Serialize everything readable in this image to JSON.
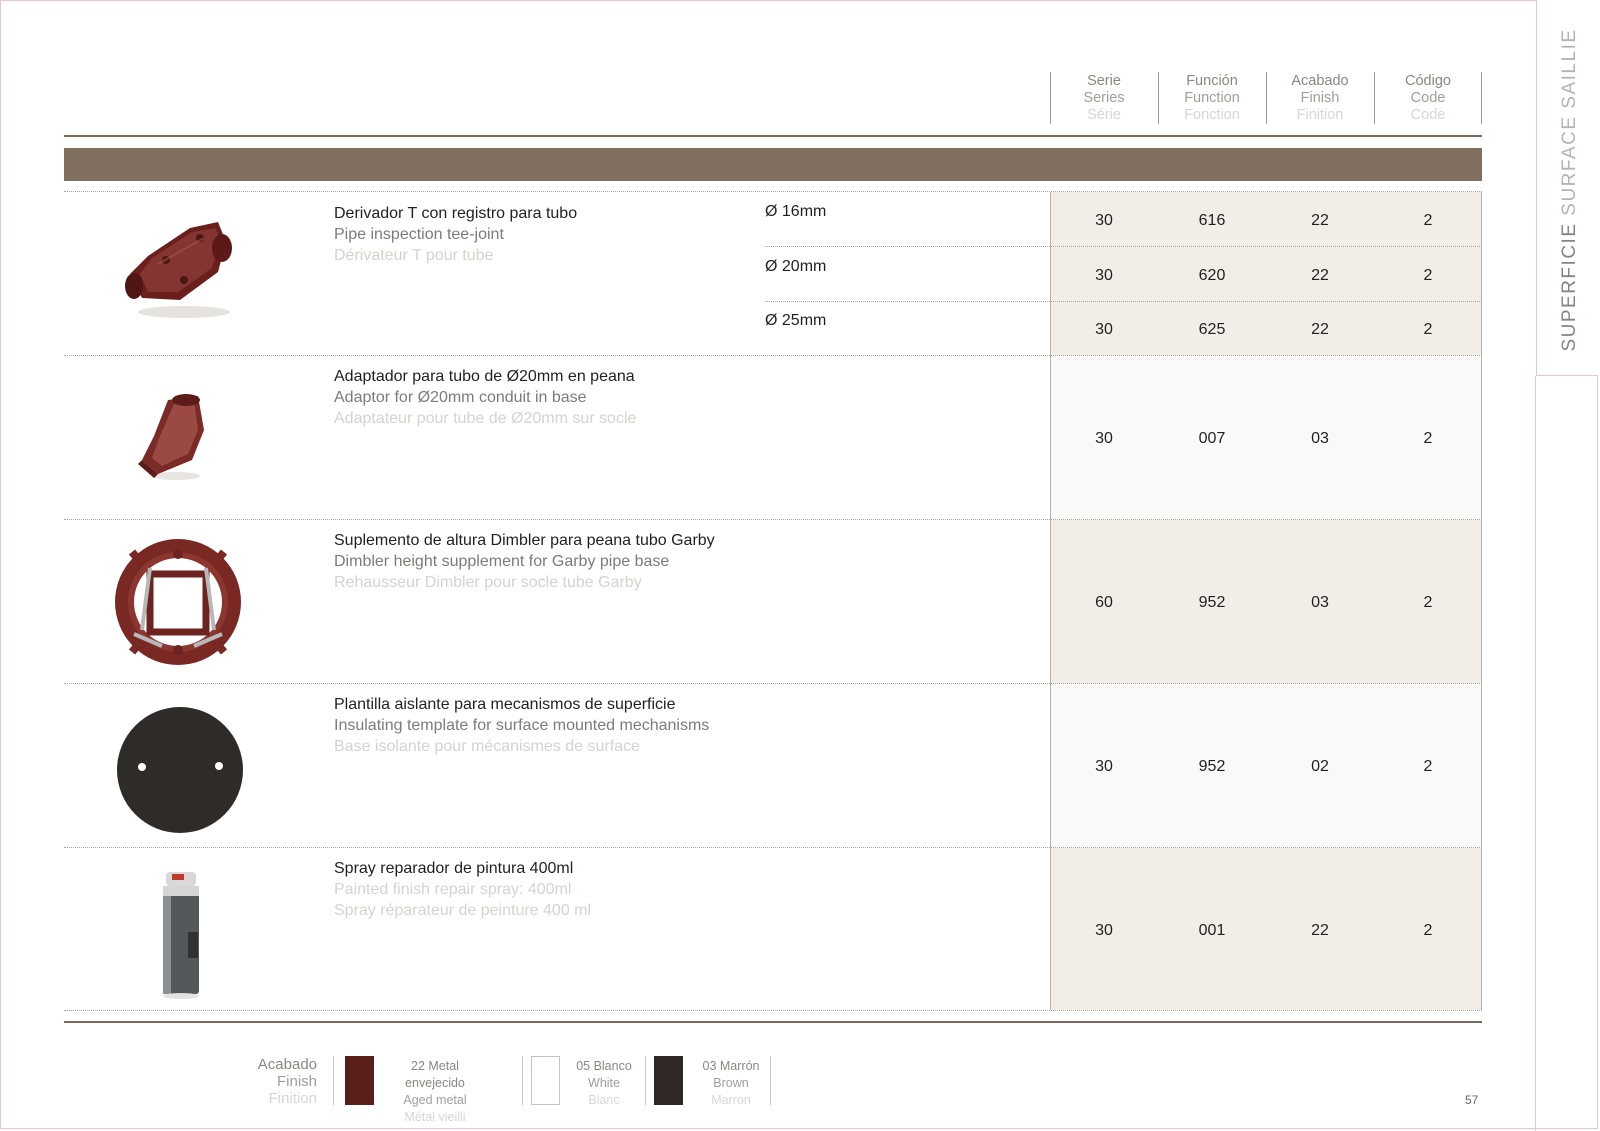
{
  "side_title": {
    "primary": "SUPERFICIE",
    "secondary": "SURFACE SAILLIE"
  },
  "header_columns": [
    {
      "es": "Serie",
      "en": "Series",
      "fr": "Série"
    },
    {
      "es": "Función",
      "en": "Function",
      "fr": "Fonction"
    },
    {
      "es": "Acabado",
      "en": "Finish",
      "fr": "Finition"
    },
    {
      "es": "Código",
      "en": "Code",
      "fr": "Code"
    }
  ],
  "products": [
    {
      "name_es": "Derivador T con registro para tubo",
      "name_en": "Pipe inspection tee-joint",
      "name_fr": "Dérivateur T pour tube",
      "image": "tee-joint-image",
      "variants": [
        {
          "dimension": "Ø 16mm",
          "serie": "30",
          "funcion": "616",
          "acabado": "22",
          "codigo": "2"
        },
        {
          "dimension": "Ø 20mm",
          "serie": "30",
          "funcion": "620",
          "acabado": "22",
          "codigo": "2"
        },
        {
          "dimension": "Ø 25mm",
          "serie": "30",
          "funcion": "625",
          "acabado": "22",
          "codigo": "2"
        }
      ]
    },
    {
      "name_es": "Adaptador para tubo de Ø20mm en peana",
      "name_en": "Adaptor for Ø20mm conduit in base",
      "name_fr": "Adaptateur pour tube de Ø20mm sur socle",
      "image": "conduit-adaptor-image",
      "serie": "30",
      "funcion": "007",
      "acabado": "03",
      "codigo": "2"
    },
    {
      "name_es": "Suplemento de altura Dimbler para peana tubo Garby",
      "name_en": "Dimbler height supplement for Garby pipe base",
      "name_fr": "Rehausseur Dimbler pour socle tube Garby",
      "image": "height-supplement-image",
      "serie": "60",
      "funcion": "952",
      "acabado": "03",
      "codigo": "2"
    },
    {
      "name_es": "Plantilla aislante para mecanismos de superficie",
      "name_en": "Insulating template for surface mounted mechanisms",
      "name_fr": "Base isolante pour mécanismes de surface",
      "image": "insulating-template-image",
      "serie": "30",
      "funcion": "952",
      "acabado": "02",
      "codigo": "2"
    },
    {
      "name_es": "Spray reparador de pintura 400ml",
      "name_en": "Painted finish repair spray: 400ml",
      "name_fr": "Spray réparateur de peinture 400 ml",
      "image": "spray-can-image",
      "serie": "30",
      "funcion": "001",
      "acabado": "22",
      "codigo": "2"
    }
  ],
  "finish_legend": {
    "label_es": "Acabado",
    "label_en": "Finish",
    "label_fr": "Finition",
    "items": [
      {
        "es": "22 Metal envejecido",
        "en": "Aged metal",
        "fr": "Métal vieilli",
        "color": "#5a1f1a"
      },
      {
        "es": "05 Blanco",
        "en": "White",
        "fr": "Blanc",
        "color": "#ffffff"
      },
      {
        "es": "03 Marrón",
        "en": "Brown",
        "fr": "Marron",
        "color": "#2f2826"
      }
    ]
  },
  "page_number": "57"
}
